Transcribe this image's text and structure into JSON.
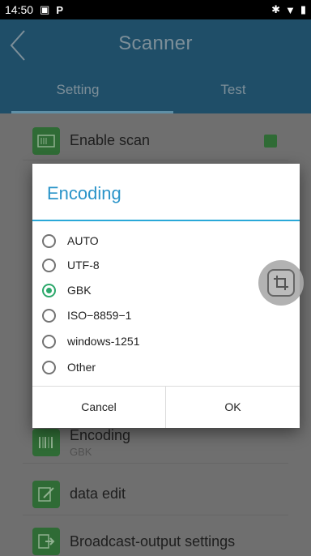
{
  "status_bar": {
    "time": "14:50",
    "icons": [
      "gallery-icon",
      "p-icon",
      "bluetooth-icon",
      "wifi-icon"
    ]
  },
  "app_bar": {
    "title": "Scanner",
    "back_icon": "chevron-left-icon"
  },
  "tabs": [
    {
      "label": "Setting",
      "selected": true
    },
    {
      "label": "Test",
      "selected": false
    }
  ],
  "settings": {
    "enable_scan": {
      "label": "Enable scan",
      "checked": true
    },
    "encoding": {
      "label": "Encoding",
      "value": "GBK"
    },
    "data_edit": {
      "label": "data edit"
    },
    "broadcast": {
      "label": "Broadcast-output settings"
    }
  },
  "dialog": {
    "title": "Encoding",
    "options": [
      "AUTO",
      "UTF-8",
      "GBK",
      "ISO−8859−1",
      "windows-1251",
      "Other"
    ],
    "selected": "GBK",
    "cancel_label": "Cancel",
    "ok_label": "OK"
  },
  "colors": {
    "accent": "#2aa8d8",
    "radio_selected": "#2ca86b",
    "app_bar": "#1f4e68"
  }
}
